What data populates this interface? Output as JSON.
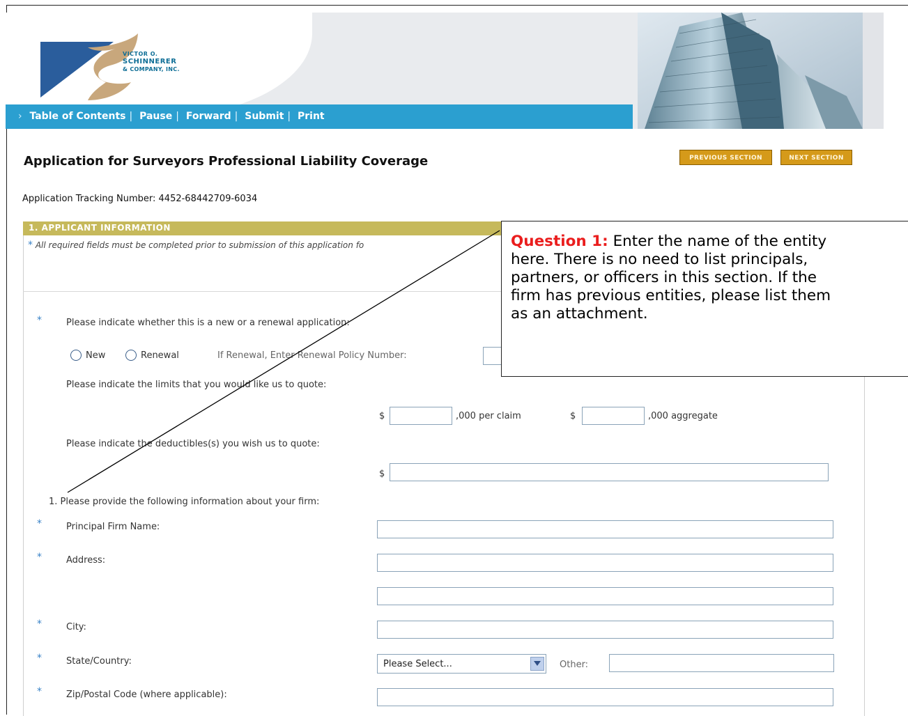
{
  "header": {
    "logo_line1": "VICTOR O.",
    "logo_line2": "SCHINNERER",
    "logo_line3": "& COMPANY, INC."
  },
  "nav": {
    "items": [
      "Table of Contents",
      "Pause",
      "Forward",
      "Submit",
      "Print"
    ]
  },
  "page": {
    "title": "Application for Surveyors Professional Liability Coverage",
    "prev_button": "PREVIOUS SECTION",
    "next_button": "NEXT SECTION",
    "tracking": "Application Tracking Number: 4452-68442709-6034"
  },
  "section": {
    "title": "1. APPLICANT INFORMATION",
    "required_note": "All required fields must be completed prior to submission of this application fo"
  },
  "form": {
    "star": "*",
    "q_new_renewal": "Please indicate whether this is a new or a renewal application:",
    "radio_new": "New",
    "radio_renewal": "Renewal",
    "renewal_policy_label": "If Renewal, Enter Renewal Policy Number:",
    "q_limits": "Please indicate the limits that you would like us to quote:",
    "dollar": "$",
    "per_claim_suffix": ",000 per claim",
    "aggregate_suffix": ",000 aggregate",
    "q_deductibles": "Please indicate the deductibles(s) you wish us to quote:",
    "q_firm_info": "1. Please provide the following information about your firm:",
    "principal_firm_name": "Principal Firm Name:",
    "address": "Address:",
    "city": "City:",
    "state_country": "State/Country:",
    "state_select_value": "Please Select...",
    "other_label": "Other:",
    "zip": "Zip/Postal Code (where applicable):"
  },
  "callout": {
    "lead": "Question 1:",
    "line1_rest": " Enter the name of the entity",
    "line2": "here. There is no need to list principals,",
    "line3": "partners, or officers in this section. If the",
    "line4": "firm has previous entities, please list them",
    "line5": "as an attachment."
  },
  "colors": {
    "nav_blue": "#2b9fd0",
    "section_gold": "#c6b95b",
    "button_gold": "#d59a1a",
    "callout_red": "#ea1d1d"
  }
}
